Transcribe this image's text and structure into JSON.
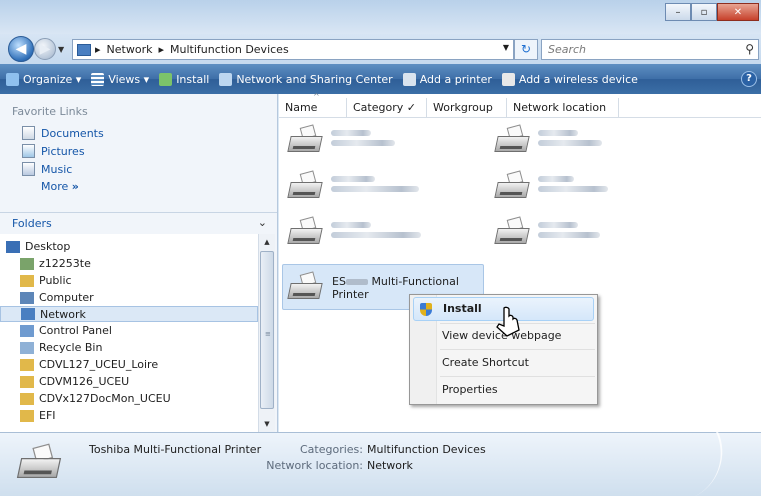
{
  "window": {
    "caption_minimize": "–",
    "caption_maximize": "▫",
    "caption_close": "✕"
  },
  "address": {
    "back_arrow": "◀",
    "fwd_arrow": "▶",
    "crumb_sep": "▸",
    "crumbs": [
      "Network",
      "Multifunction Devices"
    ],
    "refresh": "↻",
    "search_placeholder": "Search",
    "search_icon": "⚲"
  },
  "toolbar": {
    "items": [
      {
        "label": "Organize",
        "icon": "organize-icon",
        "dropdown": true
      },
      {
        "label": "Views",
        "icon": "views-icon",
        "dropdown": true
      },
      {
        "label": "Install",
        "icon": "install-icon"
      },
      {
        "label": "Network and Sharing Center",
        "icon": "network-sharing-icon"
      },
      {
        "label": "Add a printer",
        "icon": "add-printer-icon"
      },
      {
        "label": "Add a wireless device",
        "icon": "wireless-device-icon"
      }
    ],
    "help": "?"
  },
  "leftpane": {
    "favorite_links_title": "Favorite Links",
    "favorites": [
      "Documents",
      "Pictures",
      "Music"
    ],
    "more_label": "More",
    "more_glyph": "»",
    "folders_title": "Folders",
    "folders_chevron": "⌄",
    "tree": [
      {
        "label": "Desktop",
        "indent": 0,
        "icon": "desktop-icon",
        "color": "#3a6fb5"
      },
      {
        "label": "z12253te",
        "indent": 1,
        "icon": "user-icon",
        "color": "#7aa36a"
      },
      {
        "label": "Public",
        "indent": 1,
        "icon": "folder-icon",
        "color": "#e1b84a"
      },
      {
        "label": "Computer",
        "indent": 1,
        "icon": "computer-icon",
        "color": "#5d86b8"
      },
      {
        "label": "Network",
        "indent": 1,
        "icon": "network-icon",
        "color": "#4a7fc1",
        "selected": true
      },
      {
        "label": "Control Panel",
        "indent": 1,
        "icon": "control-panel-icon",
        "color": "#6f9bd0"
      },
      {
        "label": "Recycle Bin",
        "indent": 1,
        "icon": "recycle-bin-icon",
        "color": "#8fb1d6"
      },
      {
        "label": "CDVL127_UCEU_Loire",
        "indent": 1,
        "icon": "folder-icon",
        "color": "#e1b84a"
      },
      {
        "label": "CDVM126_UCEU",
        "indent": 1,
        "icon": "folder-icon",
        "color": "#e1b84a"
      },
      {
        "label": "CDVx127DocMon_UCEU",
        "indent": 1,
        "icon": "folder-icon",
        "color": "#e1b84a"
      },
      {
        "label": "EFI",
        "indent": 1,
        "icon": "folder-icon",
        "color": "#e1b84a"
      }
    ]
  },
  "columns": [
    {
      "label": "Name",
      "sorted": true
    },
    {
      "label": "Category"
    },
    {
      "label": "Workgroup",
      "checked": true
    },
    {
      "label": "Network location"
    }
  ],
  "selected_item": {
    "prefix": "ES",
    "suffix": "Multi-Functional",
    "line2": "Printer"
  },
  "context_menu": {
    "items": [
      {
        "label": "Install",
        "highlighted": true,
        "shield": true
      },
      {
        "label": "View device webpage"
      },
      {
        "label": "Create Shortcut"
      },
      {
        "label": "Properties"
      }
    ]
  },
  "details": {
    "name": "Toshiba Multi-Functional Printer",
    "categories_label": "Categories:",
    "categories_value": "Multifunction Devices",
    "location_label": "Network location:",
    "location_value": "Network"
  },
  "colors": {
    "toolbar": "#3b6ea6",
    "link": "#1556a8",
    "selection": "#d7e7f8"
  }
}
